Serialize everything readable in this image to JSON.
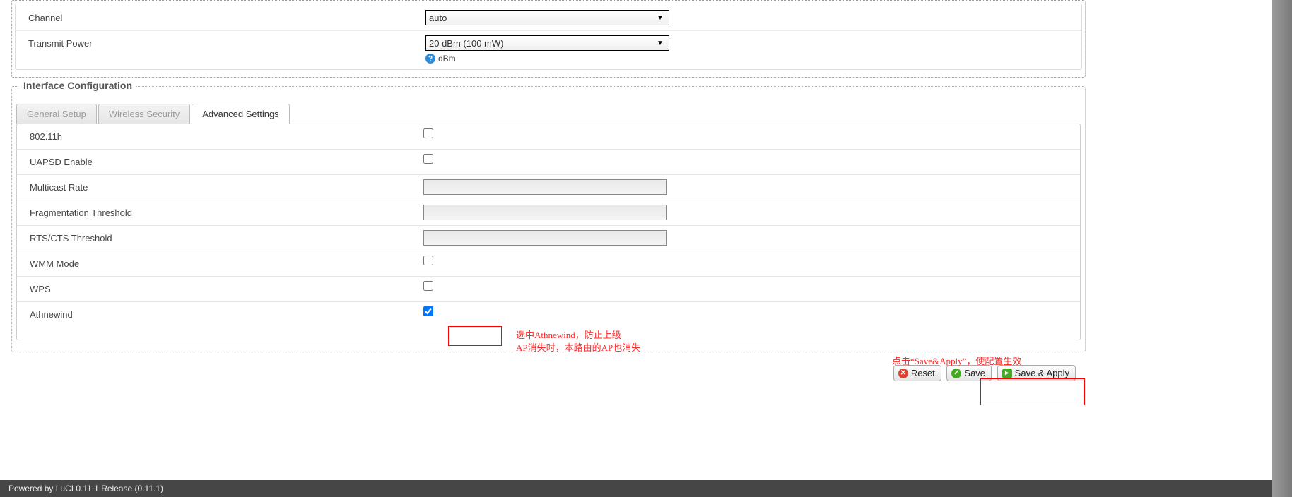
{
  "device": {
    "channel": {
      "label": "Channel",
      "value": "auto"
    },
    "txpower": {
      "label": "Transmit Power",
      "value": "20 dBm (100 mW)",
      "unit": "dBm"
    }
  },
  "interface": {
    "legend": "Interface Configuration",
    "tabs": {
      "general": "General Setup",
      "security": "Wireless Security",
      "advanced": "Advanced Settings"
    },
    "fields": {
      "dot11h": {
        "label": "802.11h",
        "checked": false
      },
      "uapsd": {
        "label": "UAPSD Enable",
        "checked": false
      },
      "mcast_rate": {
        "label": "Multicast Rate",
        "value": ""
      },
      "frag": {
        "label": "Fragmentation Threshold",
        "value": ""
      },
      "rts": {
        "label": "RTS/CTS Threshold",
        "value": ""
      },
      "wmm": {
        "label": "WMM Mode",
        "checked": false
      },
      "wps": {
        "label": "WPS",
        "checked": false
      },
      "athnewind": {
        "label": "Athnewind",
        "checked": true
      }
    }
  },
  "annotations": {
    "athnewind_note": "选中Athnewind，防止上级\nAP消失时，本路由的AP也消失",
    "saveapply_note": "点击“Save&Apply”，使配置生效"
  },
  "buttons": {
    "reset": "Reset",
    "save": "Save",
    "save_apply": "Save & Apply"
  },
  "footer": "Powered by LuCI 0.11.1 Release (0.11.1)"
}
